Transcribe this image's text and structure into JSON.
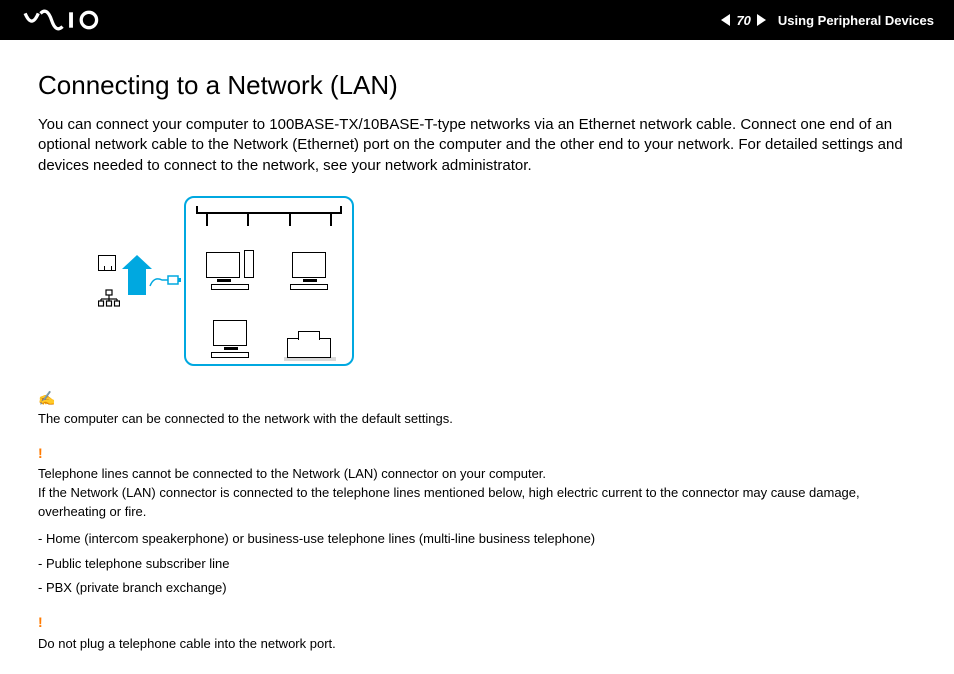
{
  "header": {
    "page_number": "70",
    "section": "Using Peripheral Devices"
  },
  "title": "Connecting to a Network (LAN)",
  "intro": "You can connect your computer to 100BASE-TX/10BASE-T-type networks via an Ethernet network cable. Connect one end of an optional network cable to the Network (Ethernet) port on the computer and the other end to your network. For detailed settings and devices needed to connect to the network, see your network administrator.",
  "note1": "The computer can be connected to the network with the default settings.",
  "warn1_p1": "Telephone lines cannot be connected to the Network (LAN) connector on your computer.",
  "warn1_p2": "If the Network (LAN) connector is connected to the telephone lines mentioned below, high electric current to the connector may cause damage, overheating or fire.",
  "bullets": [
    "Home (intercom speakerphone) or business-use telephone lines (multi-line business telephone)",
    "Public telephone subscriber line",
    "PBX (private branch exchange)"
  ],
  "warn2": "Do not plug a telephone cable into the network port."
}
